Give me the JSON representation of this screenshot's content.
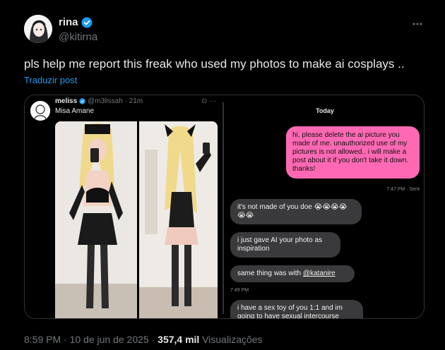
{
  "author": {
    "name": "rina",
    "handle": "@kitirna",
    "verified_color": "#1d9bf0"
  },
  "tweet": {
    "text": "pls help me report this freak who used my photos to make ai cosplays ..",
    "translate_label": "Traduzir post"
  },
  "embedded_post": {
    "name": "meliss",
    "handle": "@m3lissah · 21m",
    "text": "Misa Amane"
  },
  "chat": {
    "date": "Today",
    "sent_message": "hi, please delete the ai picture you made of me. unauthorized use of my pictures is not allowed.. i will make a post about it if you don't take it down. thanks!",
    "sent_status": "7:47 PM · Sent",
    "replies": [
      "it's not made of you doe 😭😭😭😭😭😭",
      "i just gave AI your photo as inspiration",
      "same thing was with @katanire",
      "i have a sex toy of you 1:1 and im going to have sexual intercourse"
    ],
    "reply_mention": "@katanire",
    "reply_time": "7:49 PM"
  },
  "footer": {
    "time": "8:59 PM",
    "date": "10 de jun de 2025",
    "views_count": "357,4 mil",
    "views_label": "Visualizações"
  },
  "colors": {
    "background": "#000000",
    "link": "#1d9bf0",
    "sent_bubble": "#ff69b4",
    "received_bubble": "#3a3a3c"
  }
}
